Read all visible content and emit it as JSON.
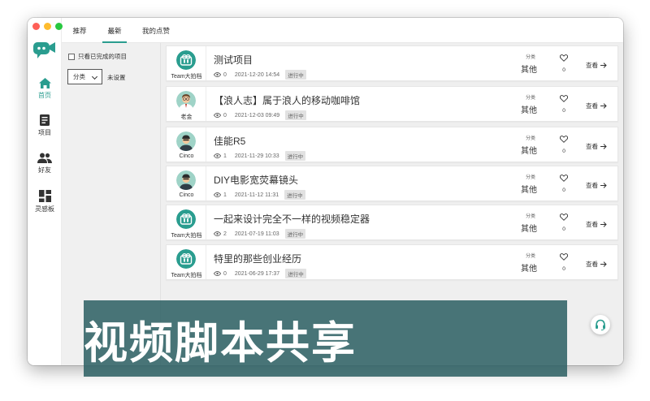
{
  "topbar": {
    "tabs": [
      {
        "label": "推荐",
        "active": false
      },
      {
        "label": "最新",
        "active": true
      },
      {
        "label": "我的点赞",
        "active": false
      }
    ]
  },
  "sidebar": {
    "items": [
      {
        "label": "首页",
        "icon": "home-icon",
        "active": true
      },
      {
        "label": "项目",
        "icon": "project-icon",
        "active": false
      },
      {
        "label": "好友",
        "icon": "friends-icon",
        "active": false
      },
      {
        "label": "灵感板",
        "icon": "dashboard-icon",
        "active": false
      }
    ]
  },
  "filter": {
    "only_completed_label": "只看已完成的项目",
    "category_button_label": "分类",
    "category_value": "未设置"
  },
  "cards": [
    {
      "author": "Team大拍档",
      "avatar": "team-logo",
      "title": "测试项目",
      "views": "0",
      "date": "2021-12-20 14:54",
      "status": "进行中",
      "category_label": "分类",
      "category": "其他",
      "likes": "0",
      "view_label": "查看"
    },
    {
      "author": "老金",
      "avatar": "person-glasses",
      "title": "【浪人志】属于浪人的移动咖啡馆",
      "views": "0",
      "date": "2021-12-03 09:49",
      "status": "进行中",
      "category_label": "分类",
      "category": "其他",
      "likes": "0",
      "view_label": "查看"
    },
    {
      "author": "Cinco",
      "avatar": "person-dark",
      "title": "佳能R5",
      "views": "1",
      "date": "2021-11-29 10:33",
      "status": "进行中",
      "category_label": "分类",
      "category": "其他",
      "likes": "0",
      "view_label": "查看"
    },
    {
      "author": "Cinco",
      "avatar": "person-dark",
      "title": "DIY电影宽荧幕镜头",
      "views": "1",
      "date": "2021-11-12 11:31",
      "status": "进行中",
      "category_label": "分类",
      "category": "其他",
      "likes": "0",
      "view_label": "查看"
    },
    {
      "author": "Team大拍档",
      "avatar": "team-logo",
      "title": "一起来设计完全不一样的视频稳定器",
      "views": "2",
      "date": "2021-07-19 11:03",
      "status": "进行中",
      "category_label": "分类",
      "category": "其他",
      "likes": "0",
      "view_label": "查看"
    },
    {
      "author": "Team大拍档",
      "avatar": "team-logo",
      "title": "特里的那些创业经历",
      "views": "0",
      "date": "2021-06-29 17:37",
      "status": "进行中",
      "category_label": "分类",
      "category": "其他",
      "likes": "0",
      "view_label": "查看"
    }
  ],
  "banner": {
    "text": "视频脚本共享"
  },
  "colors": {
    "accent": "#2a9d8f",
    "banner": "#2c5f63",
    "pane": "#f0f0f0"
  }
}
